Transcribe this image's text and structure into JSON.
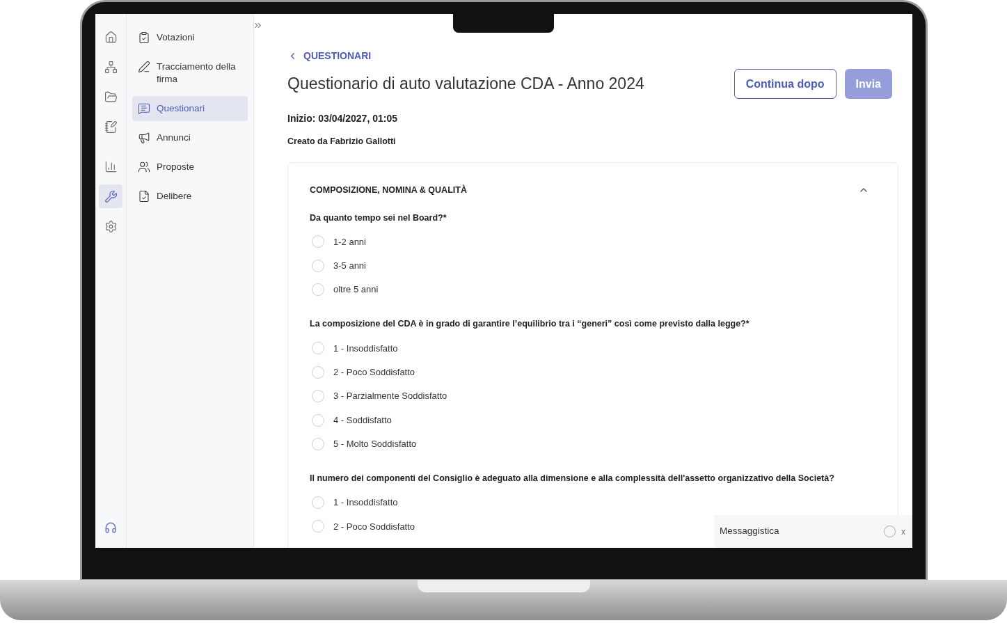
{
  "rail_items": [
    {
      "selected": false
    },
    {
      "selected": false
    },
    {
      "selected": false
    },
    {
      "selected": false
    },
    {
      "selected": false
    },
    {
      "selected": true
    },
    {
      "selected": false
    }
  ],
  "sidebar": {
    "items": [
      {
        "label": "Votazioni",
        "selected": false
      },
      {
        "label": "Tracciamento della firma",
        "selected": false
      },
      {
        "label": "Questionari",
        "selected": true
      },
      {
        "label": "Annunci",
        "selected": false
      },
      {
        "label": "Proposte",
        "selected": false
      },
      {
        "label": "Delibere",
        "selected": false
      }
    ]
  },
  "breadcrumb": "QUESTIONARI",
  "title": "Questionario di auto valutazione CDA - Anno 2024",
  "buttons": [
    {
      "label": "Continua dopo",
      "disabled": false
    },
    {
      "label": "Invia",
      "disabled": true
    }
  ],
  "start": "Inizio: 03/04/2027, 01:05",
  "created_by": "Creato da Fabrizio Gallotti",
  "section": {
    "title": "COMPOSIZIONE, NOMINA & QUALITÀ",
    "expanded": true,
    "questions": [
      {
        "text": "Da quanto tempo sei nel Board?*",
        "options": [
          {
            "label": "1-2 anni",
            "selected": false
          },
          {
            "label": "3-5 anni",
            "selected": false
          },
          {
            "label": "oltre 5 anni",
            "selected": false
          }
        ]
      },
      {
        "text": "La composizione del CDA è in grado di garantire l’equilibrio tra i “generi” così come previsto dalla legge?*",
        "options": [
          {
            "label": "1 - Insoddisfatto",
            "selected": false
          },
          {
            "label": "2 - Poco Soddisfatto",
            "selected": false
          },
          {
            "label": "3 - Parzialmente Soddisfatto",
            "selected": false
          },
          {
            "label": "4 - Soddisfatto",
            "selected": false
          },
          {
            "label": "5 - Molto Soddisfatto",
            "selected": false
          }
        ]
      },
      {
        "text": "Il numero dei componenti del Consiglio è adeguato alla dimensione e alla complessità dell'assetto organizzativo della Società?",
        "options": [
          {
            "label": "1 - Insoddisfatto",
            "selected": false
          },
          {
            "label": "2 - Poco Soddisfatto",
            "selected": false
          }
        ]
      }
    ]
  },
  "messaging": {
    "label": "Messaggistica",
    "close": "x"
  }
}
